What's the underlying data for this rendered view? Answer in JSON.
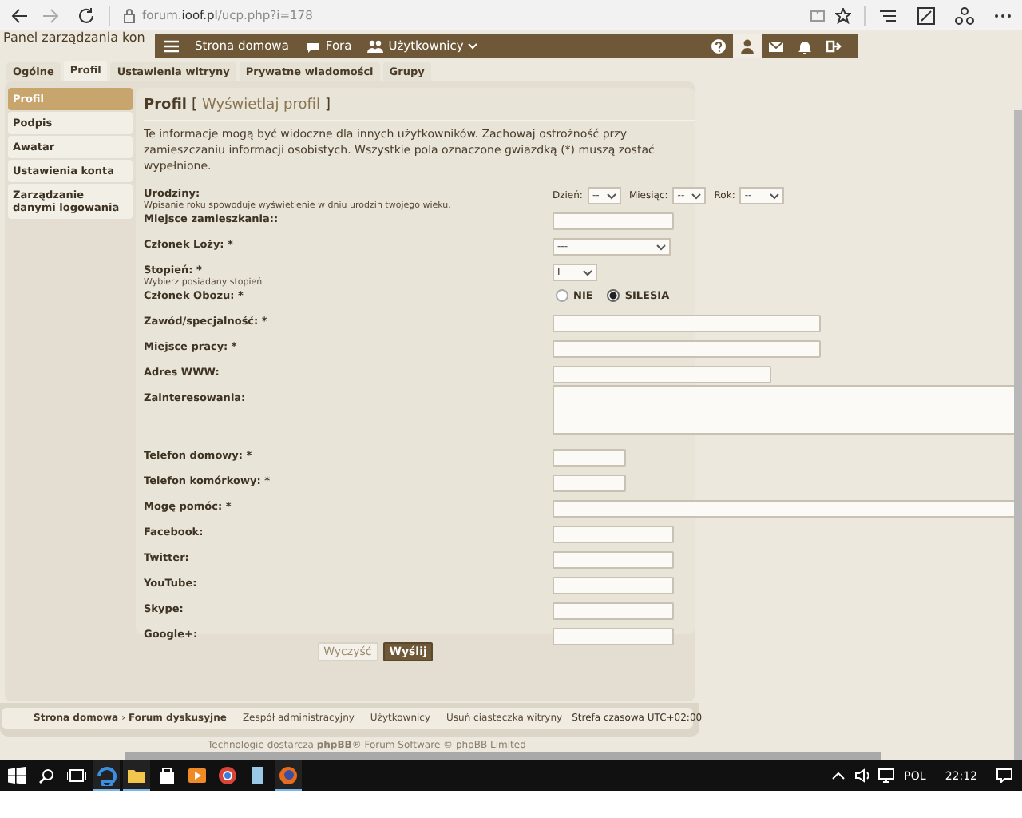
{
  "browser": {
    "url": "forum.**ioof.pl**/ucp.php?i=178"
  },
  "page_heading": "Panel zarządzania kon",
  "navbar": {
    "links": [
      {
        "label": "Strona domowa",
        "dropdown": false
      },
      {
        "label": "Fora",
        "dropdown": false
      },
      {
        "label": "Użytkownicy",
        "dropdown": true
      }
    ],
    "tools": [
      {
        "selected": false
      },
      {
        "selected": true
      },
      {
        "selected": false
      },
      {
        "selected": false
      },
      {
        "selected": false
      }
    ]
  },
  "tabs": [
    {
      "label": "Ogólne",
      "selected": false
    },
    {
      "label": "Profil",
      "selected": true
    },
    {
      "label": "Ustawienia witryny",
      "selected": false
    },
    {
      "label": "Prywatne wiadomości",
      "selected": false
    },
    {
      "label": "Grupy",
      "selected": false
    }
  ],
  "sidebar": [
    {
      "label": "Profil",
      "selected": true
    },
    {
      "label": "Podpis",
      "selected": false
    },
    {
      "label": "Awatar",
      "selected": false
    },
    {
      "label": "Ustawienia konta",
      "selected": false
    },
    {
      "label": "Zarządzanie danymi logowania",
      "selected": false
    }
  ],
  "form": {
    "title": "Profil",
    "bracket_open": "[",
    "view_link": "Wyświetlaj profil",
    "bracket_close": "]",
    "intro": "Te informacje mogą być widoczne dla innych użytkowników. Zachowaj ostrożność przy zamieszczaniu informacji osobistych. Wszystkie pola oznaczone gwiazdką (*) muszą zostać wypełnione.",
    "fields": [
      {
        "kind": "date",
        "label": "Urodziny:",
        "hint": "Wpisanie roku spowoduje wyświetlenie w dniu urodzin twojego wieku.",
        "parts": [
          {
            "label": "Dzień:",
            "value": "--"
          },
          {
            "label": "Miesiąc:",
            "value": "--"
          },
          {
            "label": "Rok:",
            "value": "--"
          }
        ]
      },
      {
        "kind": "text",
        "label": "Miejsce zamieszkania::"
      },
      {
        "kind": "select",
        "label": "Członek Loży: *",
        "value": "---"
      },
      {
        "kind": "select",
        "label": "Stopień: *",
        "hint": "Wybierz posiadany stopień",
        "value": "I"
      },
      {
        "kind": "radio",
        "label": "Członek Obozu: *",
        "options": [
          {
            "label": "NIE",
            "selected": false
          },
          {
            "label": "SILESIA",
            "selected": true
          }
        ]
      },
      {
        "kind": "text",
        "label": "Zawód/specjalność: *"
      },
      {
        "kind": "text",
        "label": "Miejsce pracy: *"
      },
      {
        "kind": "text",
        "label": "Adres WWW:"
      },
      {
        "kind": "textarea",
        "label": "Zainteresowania:"
      },
      {
        "kind": "text",
        "label": "Telefon domowy: *"
      },
      {
        "kind": "text",
        "label": "Telefon komórkowy: *"
      },
      {
        "kind": "text",
        "label": "Mogę pomóc: *"
      },
      {
        "kind": "text",
        "label": "Facebook:"
      },
      {
        "kind": "text",
        "label": "Twitter:"
      },
      {
        "kind": "text",
        "label": "YouTube:"
      },
      {
        "kind": "text",
        "label": "Skype:"
      },
      {
        "kind": "text",
        "label": "Google+:"
      }
    ],
    "buttons": [
      {
        "label": "Wyczyść",
        "kind": "reset"
      },
      {
        "label": "Wyślij",
        "kind": "submit"
      }
    ]
  },
  "footer": {
    "breadcrumbs": [
      "Strona domowa",
      "Forum dyskusyjne"
    ],
    "separator": "›",
    "links": [
      "Zespół administracyjny",
      "Użytkownicy",
      "Usuń ciasteczka witryny"
    ],
    "timezone": "Strefa czasowa UTC+02:00",
    "credit": "Technologie dostarcza **phpBB**® Forum Software © phpBB Limited"
  },
  "taskbar": {
    "apps": [
      {
        "running": true
      },
      {
        "running": true
      },
      {
        "running": false
      },
      {
        "running": false
      },
      {
        "running": false
      },
      {
        "running": false
      },
      {
        "running": true
      }
    ],
    "language": "POL",
    "time": "22:12"
  }
}
